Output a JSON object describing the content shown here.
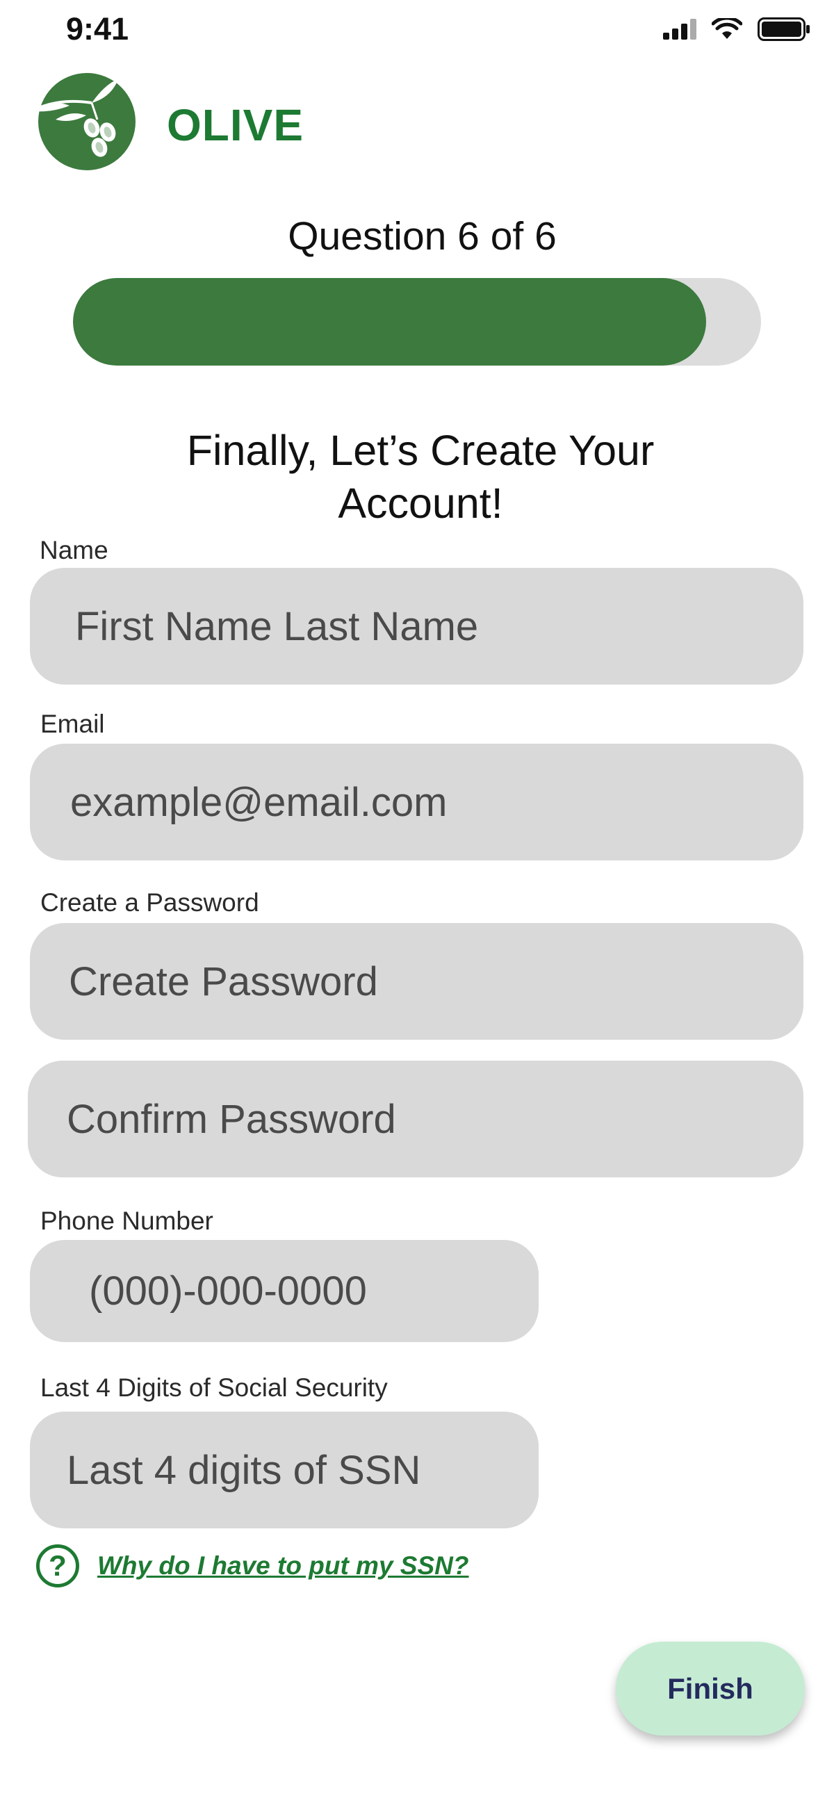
{
  "status_bar": {
    "time": "9:41"
  },
  "brand": {
    "name": "OLIVE",
    "color": "#1d7a32"
  },
  "progress": {
    "label": "Question 6 of 6",
    "fraction": 0.92,
    "fill_color": "#3c7a3e",
    "track_color": "#dcdcdc"
  },
  "heading": "Finally, Let’s Create Your Account!",
  "form": {
    "name": {
      "label": "Name",
      "placeholder": "First Name Last Name"
    },
    "email": {
      "label": "Email",
      "placeholder": "example@email.com"
    },
    "password": {
      "label": "Create a Password",
      "placeholder": "Create Password",
      "confirm_placeholder": "Confirm Password"
    },
    "phone": {
      "label": "Phone Number",
      "placeholder": "(000)-000-0000"
    },
    "ssn": {
      "label": "Last 4 Digits of Social Security",
      "placeholder": "Last 4 digits of SSN"
    }
  },
  "help": {
    "icon": "question-circle-icon",
    "icon_glyph": "?",
    "link_text": "Why do I have to put my SSN?"
  },
  "finish_button": {
    "label": "Finish",
    "background": "#c5ecd3",
    "text_color": "#242a5e"
  }
}
